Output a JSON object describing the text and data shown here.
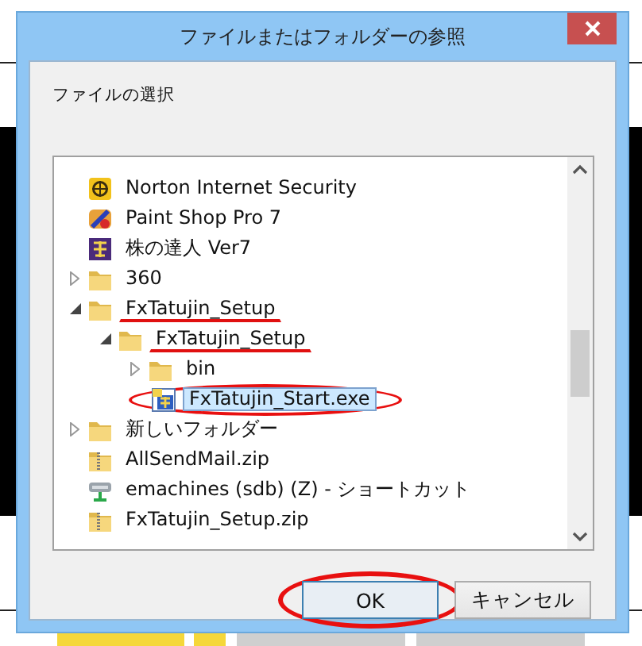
{
  "window": {
    "title": "ファイルまたはフォルダーの参照"
  },
  "prompt": "ファイルの選択",
  "tree": [
    {
      "label": "Norton Internet Security",
      "kind": "globe",
      "selected": false
    },
    {
      "label": "Paint Shop Pro 7",
      "kind": "brush",
      "selected": false
    },
    {
      "label": "株の達人 Ver7",
      "kind": "badge",
      "selected": false
    },
    {
      "label": "360",
      "kind": "folder",
      "expanded": false,
      "selected": false
    },
    {
      "label": "FxTatujin_Setup",
      "kind": "folder",
      "expanded": true,
      "selected": false,
      "underlined": true,
      "children": [
        {
          "label": "FxTatujin_Setup",
          "kind": "folder",
          "expanded": true,
          "selected": false,
          "underlined": true,
          "children": [
            {
              "label": "bin",
              "kind": "folder",
              "expanded": false,
              "selected": false
            },
            {
              "label": "FxTatujin_Start.exe",
              "kind": "exe",
              "selected": true,
              "circled": true
            }
          ]
        }
      ]
    },
    {
      "label": "新しいフォルダー",
      "kind": "folder",
      "expanded": false,
      "selected": false
    },
    {
      "label": "AllSendMail.zip",
      "kind": "zip",
      "selected": false
    },
    {
      "label": "emachines (sdb) (Z) - ショートカット",
      "kind": "drive",
      "selected": false
    },
    {
      "label": "FxTatujin_Setup.zip",
      "kind": "zip",
      "selected": false
    }
  ],
  "buttons": [
    {
      "label": "OK",
      "default": true,
      "circled": true
    },
    {
      "label": "キャンセル",
      "default": false,
      "circled": false
    }
  ]
}
